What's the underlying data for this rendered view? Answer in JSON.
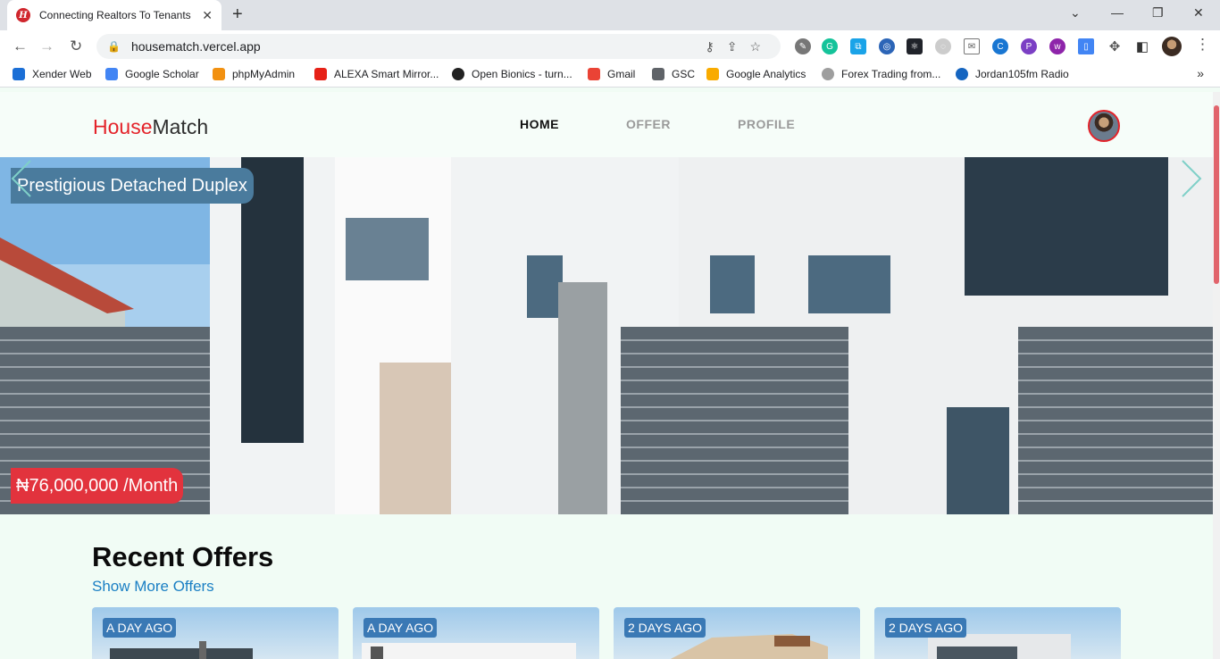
{
  "browser": {
    "tab_title": "Connecting Realtors To Tenants -",
    "url": "housematch.vercel.app",
    "bookmarks": [
      "Xender Web",
      "Google Scholar",
      "phpMyAdmin",
      "ALEXA Smart Mirror...",
      "Open Bionics - turn...",
      "Gmail",
      "GSC",
      "Google Analytics",
      "Forex Trading from...",
      "Jordan105fm Radio"
    ]
  },
  "site": {
    "logo_part1": "House",
    "logo_part2": "Match",
    "nav": [
      {
        "label": "HOME",
        "active": true
      },
      {
        "label": "OFFER",
        "active": false
      },
      {
        "label": "PROFILE",
        "active": false
      }
    ]
  },
  "hero": {
    "title": "Prestigious Detached Duplex",
    "price": "₦76,000,000 /Month"
  },
  "recent": {
    "heading": "Recent Offers",
    "show_more": "Show More Offers",
    "cards": [
      {
        "badge": "A DAY AGO"
      },
      {
        "badge": "A DAY AGO"
      },
      {
        "badge": "2 DAYS AGO"
      },
      {
        "badge": "2 DAYS AGO"
      }
    ]
  },
  "colors": {
    "brand_red": "#e4232a",
    "tag_blue": "#4a7b9d",
    "link_blue": "#1a7fc4",
    "page_bg": "#f1fcf5"
  }
}
